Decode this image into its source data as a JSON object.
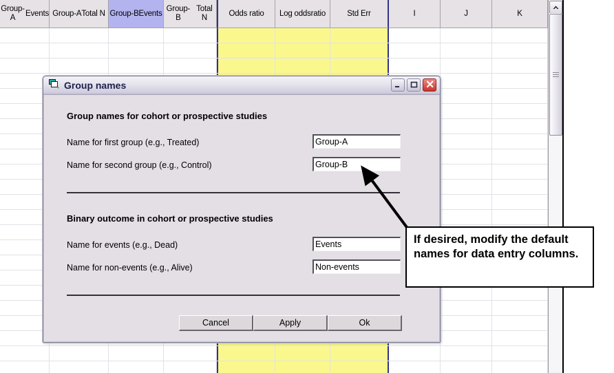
{
  "spreadsheet": {
    "columns": [
      {
        "label": "Group-A\nEvents",
        "selected": false
      },
      {
        "label": "Group-A\nTotal N",
        "selected": false
      },
      {
        "label": "Group-B\nEvents",
        "selected": true
      },
      {
        "label": "Group-B\nTotal N",
        "selected": false
      },
      {
        "label": "Odds ratio",
        "selected": false
      },
      {
        "label": "Log odds\nratio",
        "selected": false
      },
      {
        "label": "Std Err",
        "selected": false
      },
      {
        "label": "I",
        "selected": false
      },
      {
        "label": "J",
        "selected": false
      },
      {
        "label": "K",
        "selected": false
      }
    ],
    "highlight_color": "#b3b3f0",
    "computed_cell_color": "#faf88c",
    "header_color": "#e6e2e6",
    "scrollbar": {
      "up_arrow": "chevron-up-icon",
      "thumb_grip": "grip-icon"
    }
  },
  "dialog": {
    "title": "Group names",
    "title_icon": "window-cascade-icon",
    "window_buttons": {
      "minimize": "minimize-icon",
      "maximize": "maximize-icon",
      "close": "close-icon"
    },
    "sections": [
      {
        "heading": "Group names for cohort or prospective studies",
        "fields": [
          {
            "label": "Name for first group (e.g., Treated)",
            "value": "Group-A"
          },
          {
            "label": "Name for second group (e.g., Control)",
            "value": "Group-B"
          }
        ]
      },
      {
        "heading": "Binary outcome in cohort or prospective studies",
        "fields": [
          {
            "label": "Name for events (e.g., Dead)",
            "value": "Events"
          },
          {
            "label": "Name for non-events (e.g., Alive)",
            "value": "Non-events"
          }
        ]
      }
    ],
    "buttons": [
      {
        "label": "Cancel"
      },
      {
        "label": "Apply"
      },
      {
        "label": "Ok"
      }
    ]
  },
  "annotation": {
    "text": "If desired, modify the default names for data entry columns.",
    "pointer": "arrow-pointing-to-second-group-field"
  }
}
